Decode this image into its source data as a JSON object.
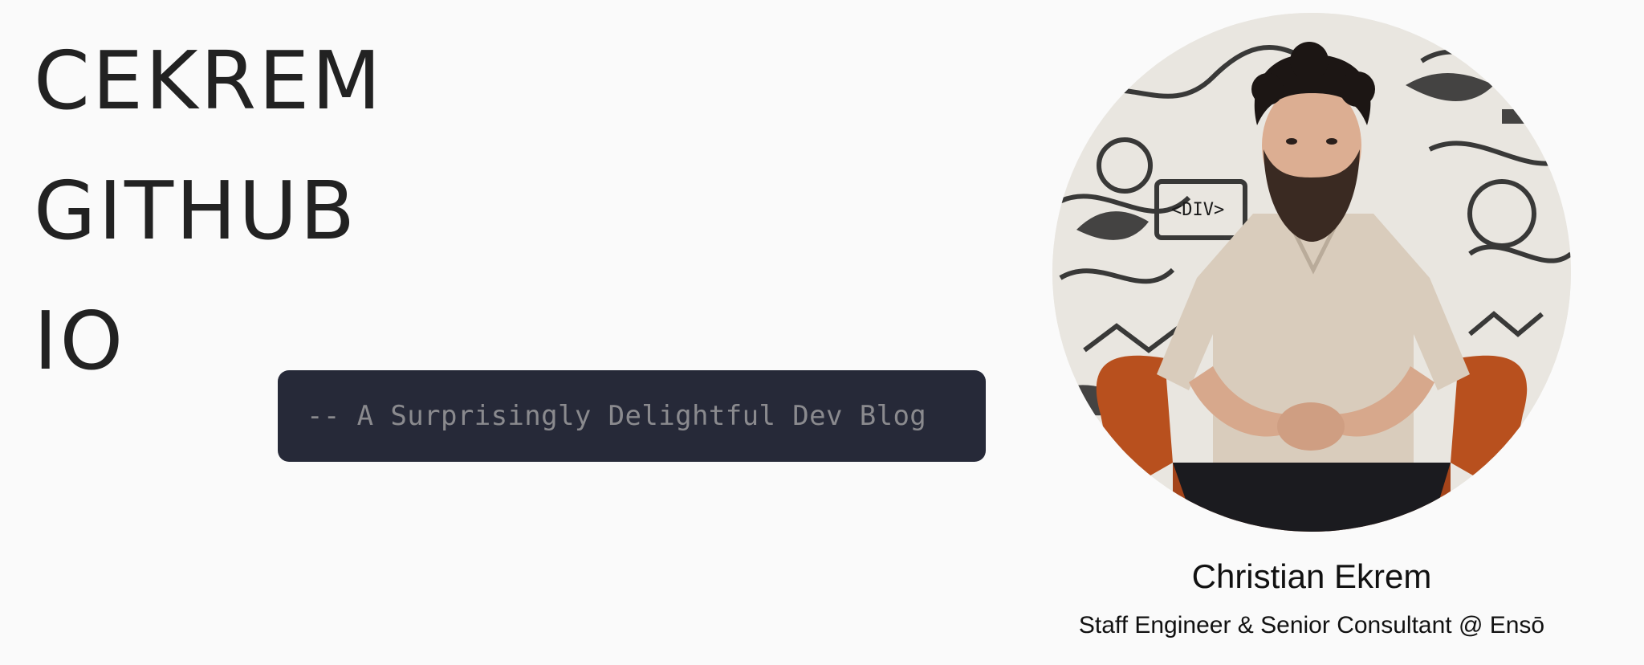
{
  "site": {
    "title_lines": [
      "CEKREM",
      "GITHUB",
      "IO"
    ]
  },
  "tagline": {
    "text": "-- A Surprisingly Delightful Dev Blog"
  },
  "profile": {
    "name": "Christian Ekrem",
    "role": "Staff Engineer & Senior Consultant @ Ensō"
  },
  "colors": {
    "page_background": "#fafafa",
    "title_text": "#222222",
    "tagline_background": "#262938",
    "tagline_text": "#8a8a8e"
  }
}
